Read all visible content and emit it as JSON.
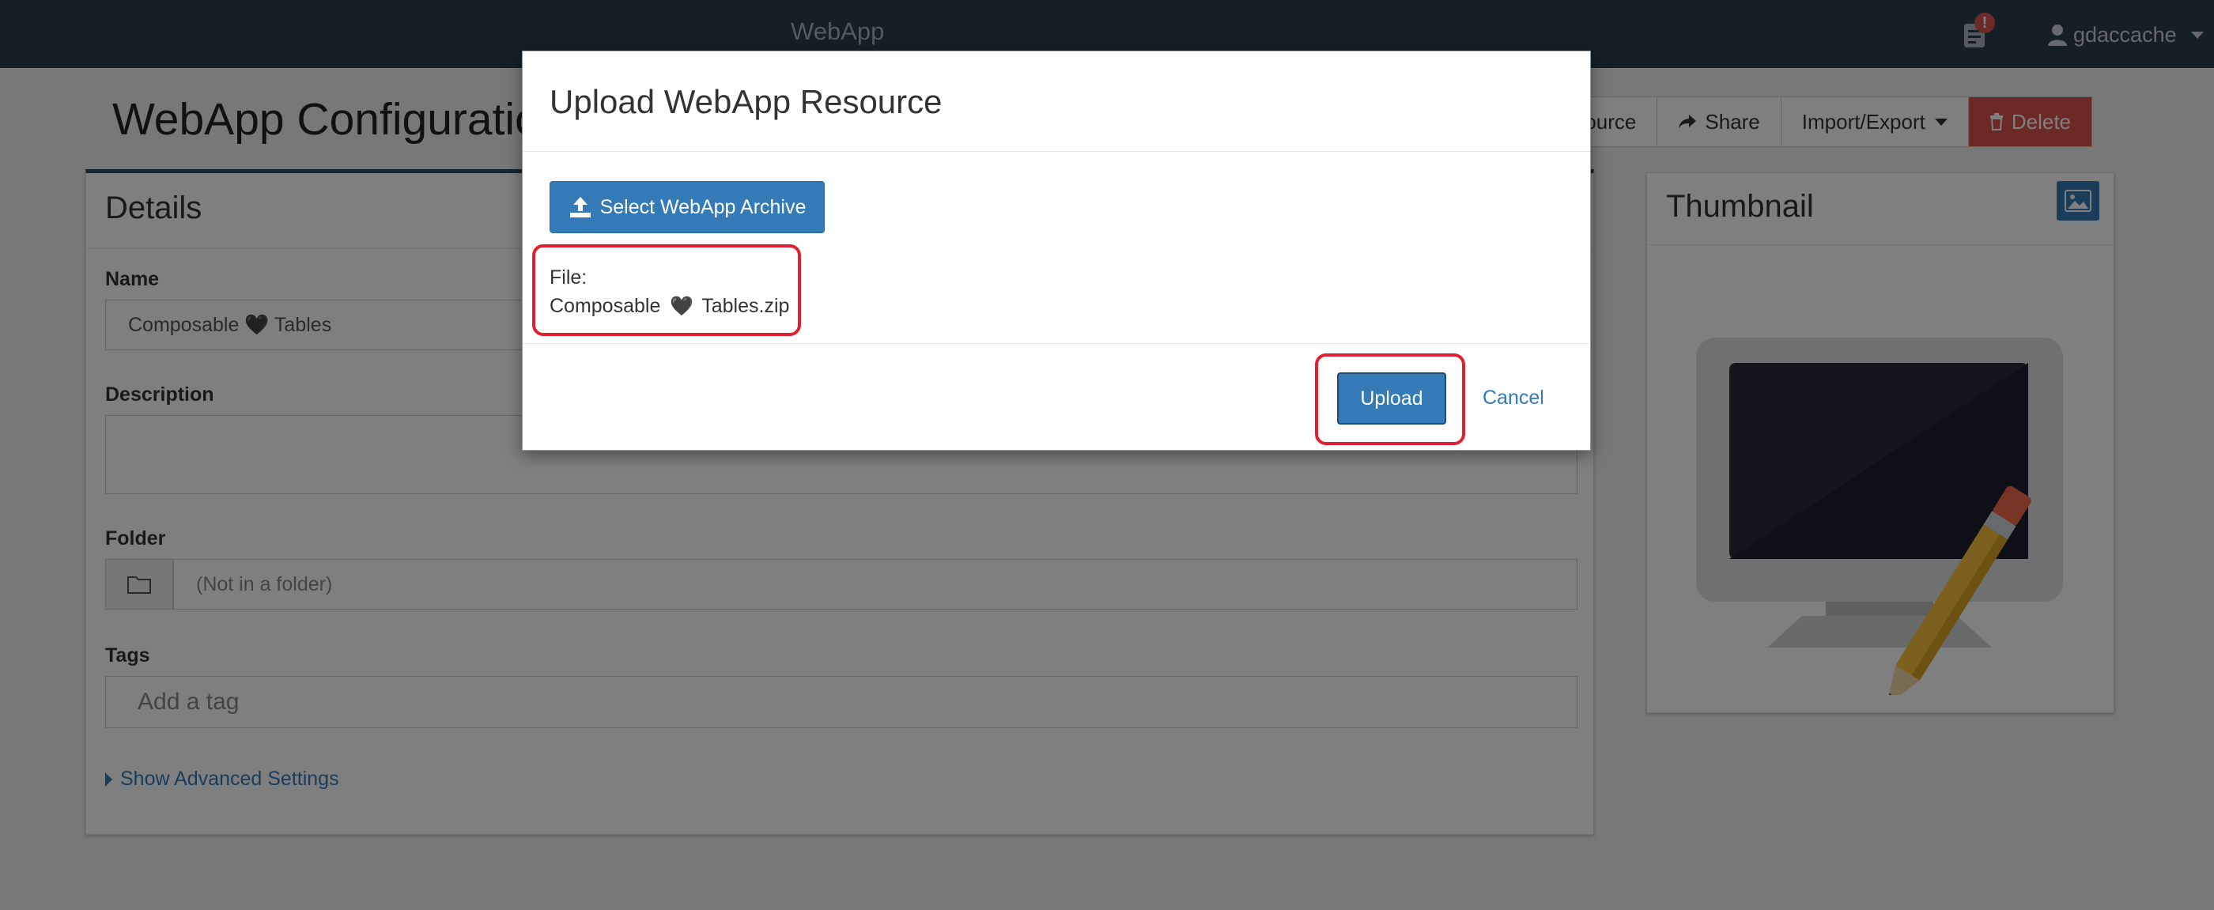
{
  "navbar": {
    "brand": "WebApp",
    "notification_badge": "!",
    "user": "gdaccache"
  },
  "header": {
    "title": "WebApp Configuration",
    "actions": {
      "source": "Source",
      "share": "Share",
      "import_export": "Import/Export",
      "delete": "Delete"
    }
  },
  "details": {
    "title": "Details",
    "name_label": "Name",
    "name_value": "Composable 🖤 Tables",
    "description_label": "Description",
    "description_value": "",
    "folder_label": "Folder",
    "folder_placeholder": "(Not in a folder)",
    "tags_label": "Tags",
    "tags_placeholder": "Add a tag",
    "advanced_link": "Show Advanced Settings"
  },
  "thumbnail": {
    "title": "Thumbnail"
  },
  "modal": {
    "title": "Upload WebApp Resource",
    "select_button": "Select WebApp Archive",
    "file_label": "File:",
    "file_name_prefix": "Composable",
    "file_name_suffix": "Tables.zip",
    "heart_glyph": "🖤",
    "upload_button": "Upload",
    "cancel_link": "Cancel"
  },
  "colors": {
    "navbar": "#2b3e50",
    "primary": "#337ab7",
    "danger": "#d9534f",
    "highlight": "#e0202f"
  }
}
